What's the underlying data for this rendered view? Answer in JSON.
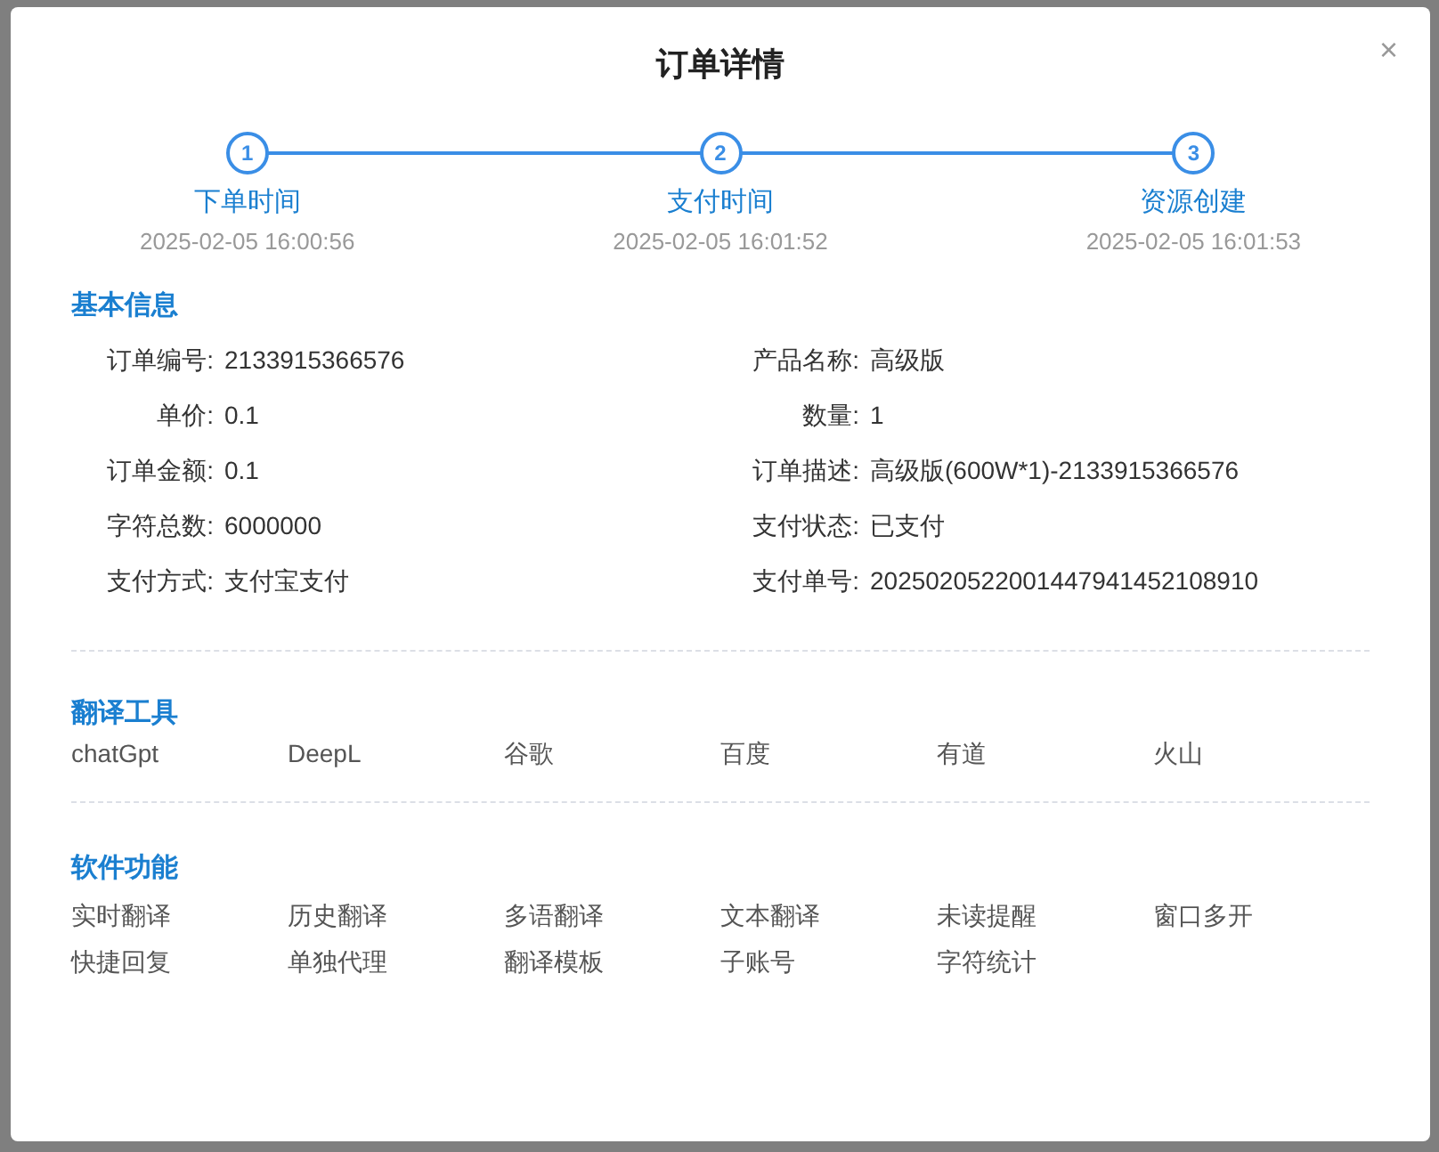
{
  "dialog": {
    "title": "订单详情",
    "close": "×"
  },
  "steps": [
    {
      "label": "下单时间",
      "number": "1",
      "time": "2025-02-05 16:00:56"
    },
    {
      "label": "支付时间",
      "number": "2",
      "time": "2025-02-05 16:01:52"
    },
    {
      "label": "资源创建",
      "number": "3",
      "time": "2025-02-05 16:01:53"
    }
  ],
  "basic_info": {
    "title": "基本信息",
    "fields": [
      {
        "label": "订单编号:",
        "value": "2133915366576"
      },
      {
        "label": "产品名称:",
        "value": "高级版"
      },
      {
        "label": "单价:",
        "value": "0.1"
      },
      {
        "label": "数量:",
        "value": "1"
      },
      {
        "label": "订单金额:",
        "value": "0.1"
      },
      {
        "label": "订单描述:",
        "value": "高级版(600W*1)-2133915366576"
      },
      {
        "label": "字符总数:",
        "value": "6000000"
      },
      {
        "label": "支付状态:",
        "value": "已支付"
      },
      {
        "label": "支付方式:",
        "value": "支付宝支付"
      },
      {
        "label": "支付单号:",
        "value": "2025020522001447941452108910"
      }
    ]
  },
  "translation_tools": {
    "title": "翻译工具",
    "items": [
      "chatGpt",
      "DeepL",
      "谷歌",
      "百度",
      "有道",
      "火山"
    ]
  },
  "software_features": {
    "title": "软件功能",
    "items": [
      "实时翻译",
      "历史翻译",
      "多语翻译",
      "文本翻译",
      "未读提醒",
      "窗口多开",
      "快捷回复",
      "单独代理",
      "翻译模板",
      "子账号",
      "字符统计"
    ]
  }
}
